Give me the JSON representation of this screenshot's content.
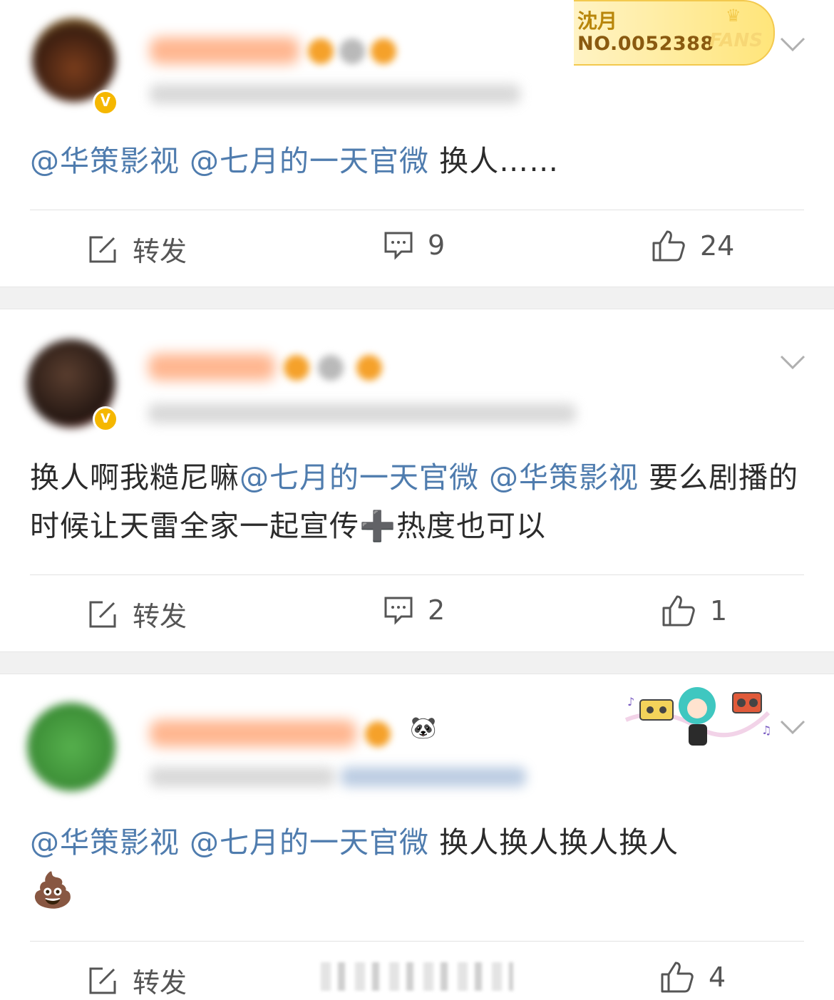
{
  "fans_badge": {
    "name": "沈月",
    "number": "NO.0052388",
    "word": "FANS"
  },
  "comments": [
    {
      "text": [
        {
          "type": "mention",
          "text": "@华策影视"
        },
        {
          "type": "plain",
          "text": " "
        },
        {
          "type": "mention",
          "text": "@七月的一天官微"
        },
        {
          "type": "plain",
          "text": " 换人……"
        }
      ],
      "actions": {
        "repost_label": "转发",
        "comment_count": "9",
        "like_count": "24"
      },
      "colors": {
        "avatar": "#6b3a1f"
      }
    },
    {
      "text": [
        {
          "type": "plain",
          "text": "换人啊我糙尼嘛"
        },
        {
          "type": "mention",
          "text": "@七月的一天官微"
        },
        {
          "type": "plain",
          "text": " "
        },
        {
          "type": "mention",
          "text": "@华策影视"
        },
        {
          "type": "plain",
          "text": " 要么剧播的时候让天雷全家一起宣传"
        },
        {
          "type": "emoji",
          "text": "➕"
        },
        {
          "type": "plain",
          "text": "热度也可以"
        }
      ],
      "actions": {
        "repost_label": "转发",
        "comment_count": "2",
        "like_count": "1"
      },
      "colors": {
        "avatar": "#3a2a24"
      }
    },
    {
      "text": [
        {
          "type": "mention",
          "text": "@华策影视"
        },
        {
          "type": "plain",
          "text": " "
        },
        {
          "type": "mention",
          "text": "@七月的一天官微"
        },
        {
          "type": "plain",
          "text": " 换人换人换人换人"
        }
      ],
      "emoji_line": "💩",
      "panda": "🐼",
      "actions": {
        "repost_label": "转发",
        "comment_count": "",
        "like_count": "4"
      },
      "colors": {
        "avatar": "#3f9b3a"
      }
    }
  ],
  "colors": {
    "mention": "#4f7cae",
    "text": "#2b2b2b",
    "separator": "#f1f1f1",
    "fans_gold": "#f3c94e"
  },
  "icons": {
    "repost": "edit-square-icon",
    "comment": "comment-bubble-icon",
    "like": "thumbs-up-icon",
    "more": "chevron-down-icon",
    "verified": "verified-v-icon"
  }
}
